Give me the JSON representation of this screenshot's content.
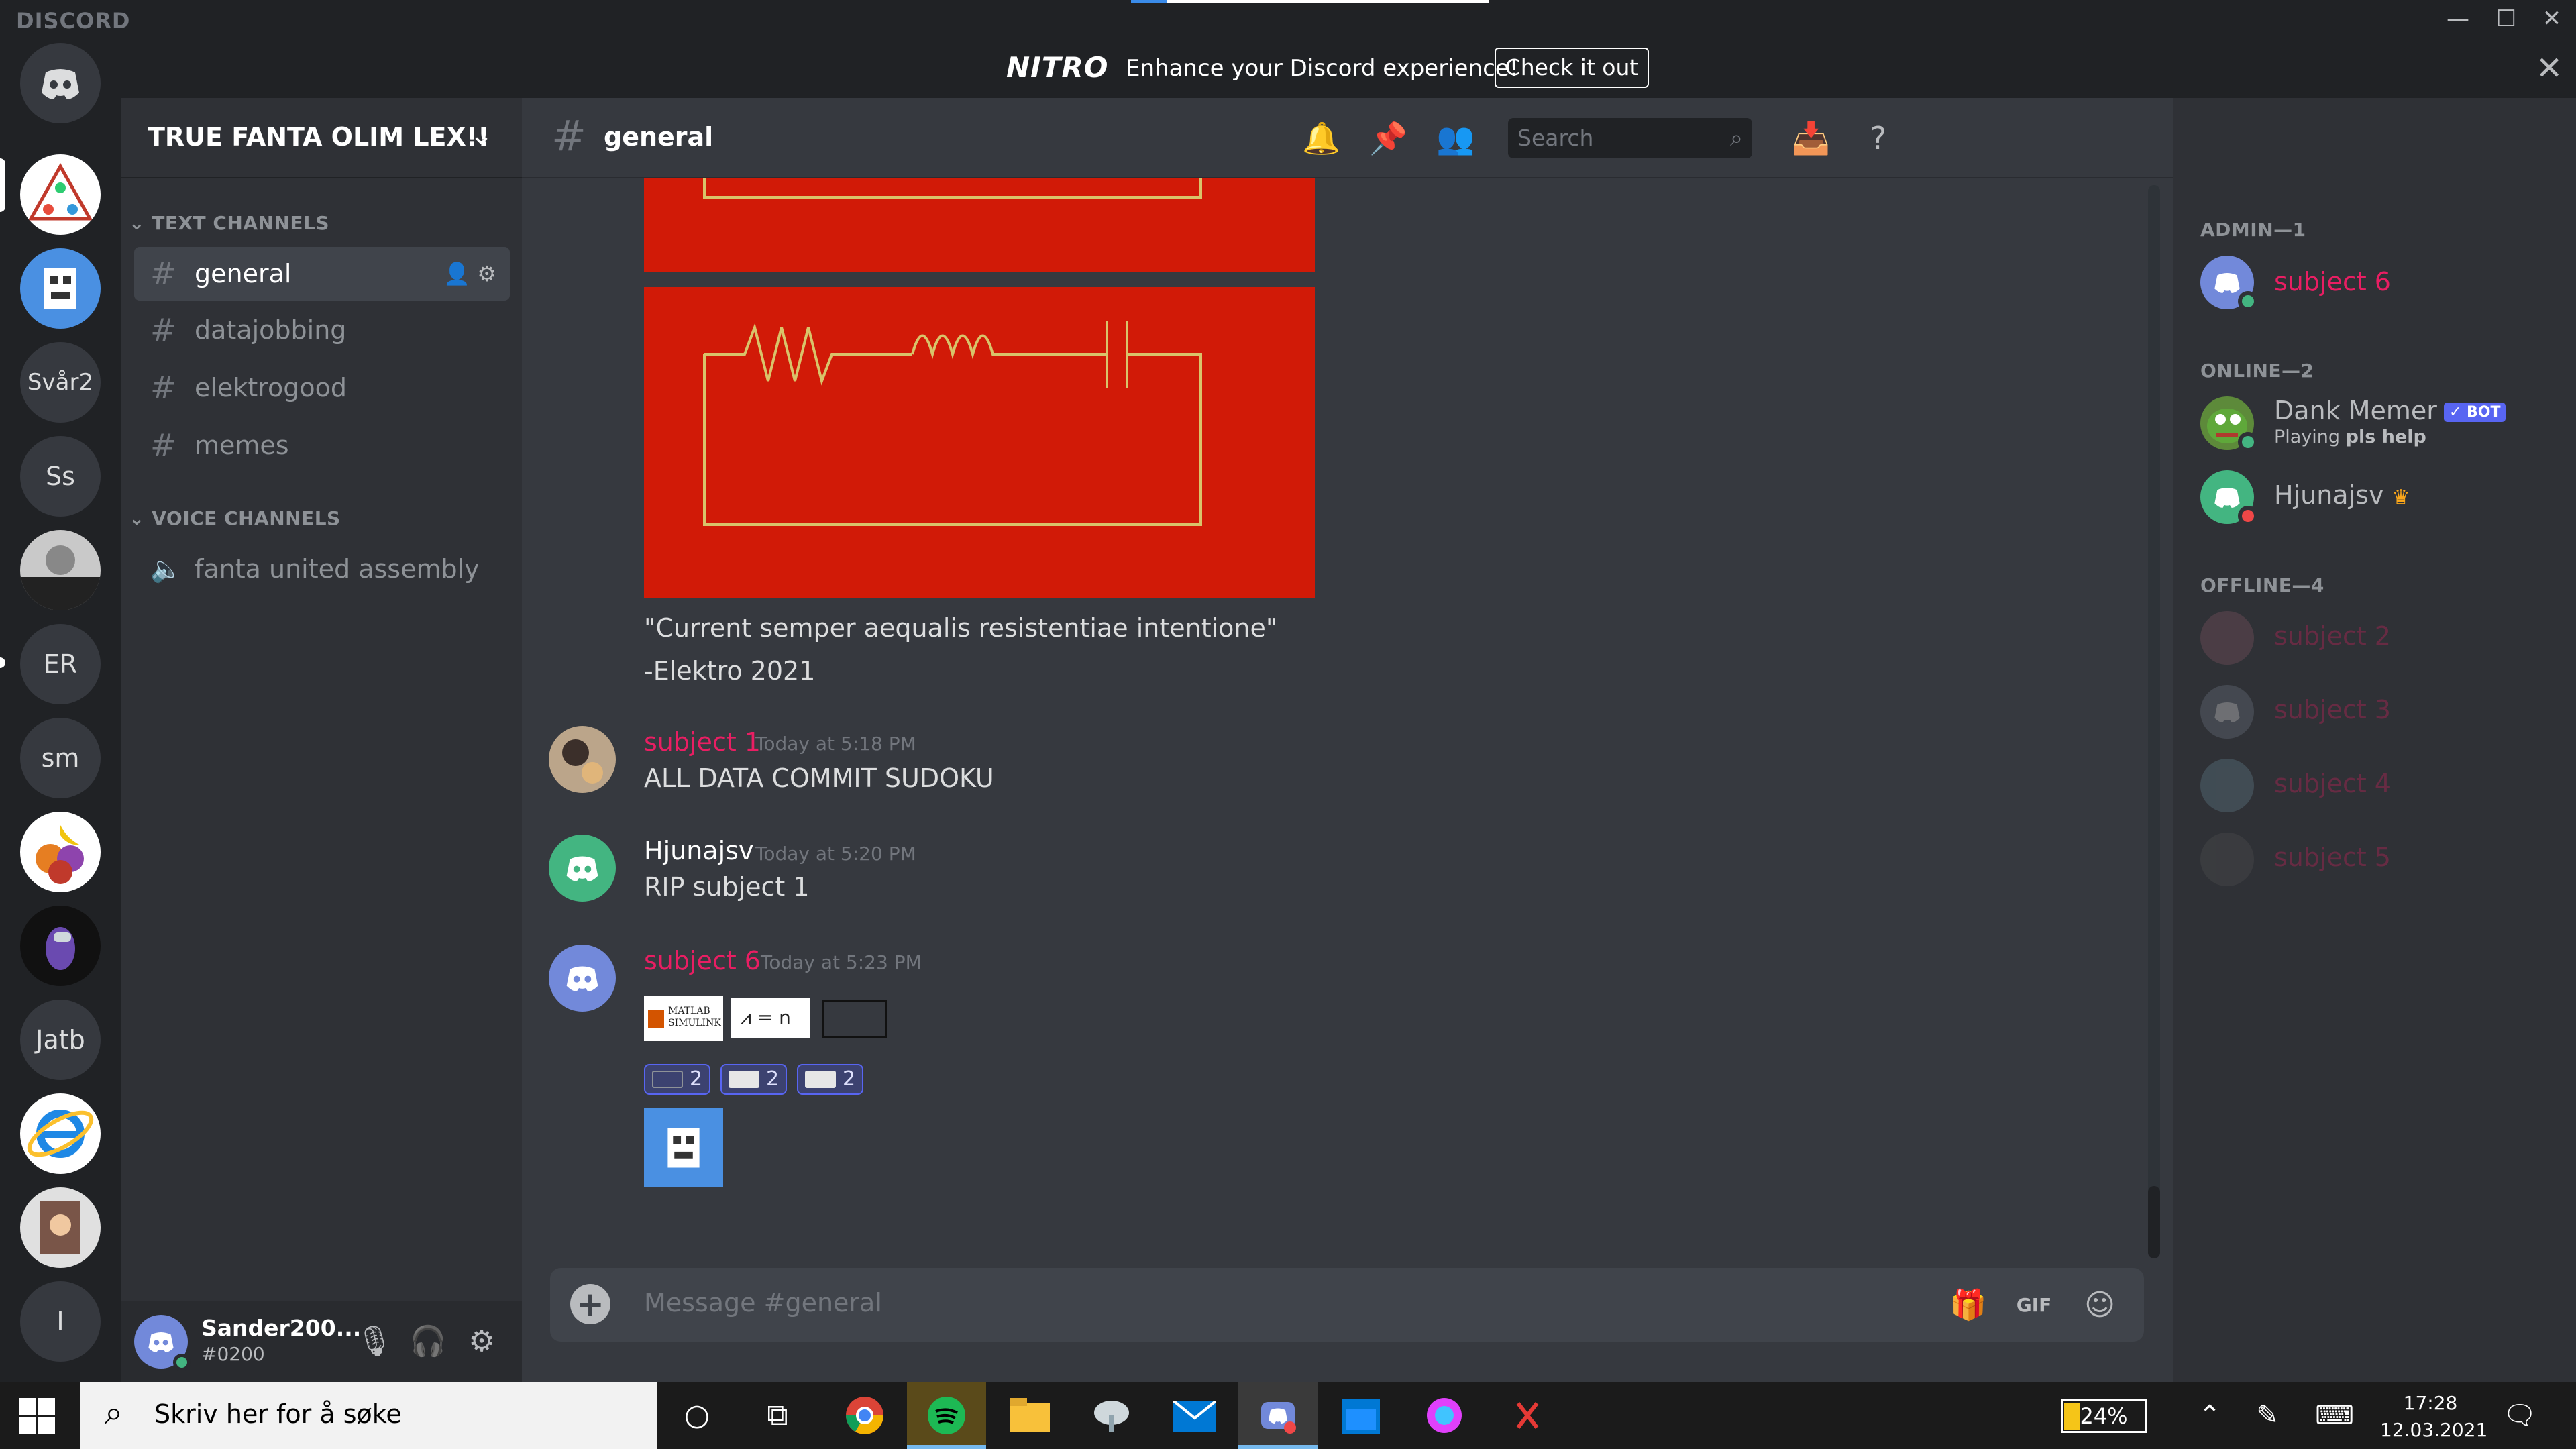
{
  "app": {
    "brand": "DISCORD"
  },
  "window_controls": {
    "minimize": "—",
    "maximize": "☐",
    "close": "✕"
  },
  "nitro": {
    "logo": "NITRO",
    "text": "Enhance your Discord experience!",
    "button": "Check it out",
    "close": "✕"
  },
  "servers": [
    {
      "label": "",
      "kind": "home"
    },
    {
      "label": "",
      "kind": "image"
    },
    {
      "label": "",
      "kind": "image"
    },
    {
      "label": "Svår2"
    },
    {
      "label": "Ss"
    },
    {
      "label": "",
      "kind": "image"
    },
    {
      "label": "ER"
    },
    {
      "label": "sm"
    },
    {
      "label": "",
      "kind": "image"
    },
    {
      "label": "",
      "kind": "image"
    },
    {
      "label": "Jatb"
    },
    {
      "label": "",
      "kind": "image"
    },
    {
      "label": "",
      "kind": "image"
    },
    {
      "label": "I"
    }
  ],
  "guild": {
    "name": "TRUE FANTA OLIM LEX!!",
    "chevron": "⌄"
  },
  "sidebar": {
    "text_category": "TEXT CHANNELS",
    "voice_category": "VOICE CHANNELS",
    "text_channels": [
      "general",
      "datajobbing",
      "elektrogood",
      "memes"
    ],
    "voice_channels": [
      "fanta united assembly"
    ]
  },
  "user": {
    "name": "Sander200...",
    "tag": "#0200"
  },
  "chat": {
    "channel": "general",
    "search_placeholder": "Search",
    "quote": "\"Current semper aequalis resistentiae intentione\"",
    "quote_author": "-Elektro 2021",
    "messages": [
      {
        "author": "subject 1",
        "time": "Today at 5:18 PM",
        "text": "ALL DATA COMMIT SUDOKU",
        "color": "#e91e63"
      },
      {
        "author": "Hjunajsv",
        "time": "Today at 5:20 PM",
        "text": "RIP subject 1",
        "color": "#ffffff"
      },
      {
        "author": "subject 6",
        "time": "Today at 5:23 PM",
        "text": "",
        "color": "#e91e63"
      }
    ],
    "attachment_labels": [
      "MATLAB SIMULINK",
      "= n"
    ],
    "reactions": [
      "2",
      "2",
      "2"
    ],
    "reaction_single": "2",
    "composer_placeholder": "Message #general"
  },
  "members": {
    "groups": [
      {
        "title": "ADMIN—1"
      },
      {
        "title": "ONLINE—2"
      },
      {
        "title": "OFFLINE—4"
      }
    ],
    "admin": [
      {
        "name": "subject 6",
        "color": "#e91e63"
      }
    ],
    "online": [
      {
        "name": "Dank Memer",
        "bot": "✓ BOT",
        "activity_prefix": "Playing ",
        "activity": "pls help"
      },
      {
        "name": "Hjunajsv",
        "badge": "♛"
      }
    ],
    "offline": [
      "subject 2",
      "subject 3",
      "subject 4",
      "subject 5"
    ]
  },
  "taskbar": {
    "search_text": "Skriv her for å søke",
    "battery": "24%",
    "time": "17:28",
    "date": "12.03.2021"
  }
}
